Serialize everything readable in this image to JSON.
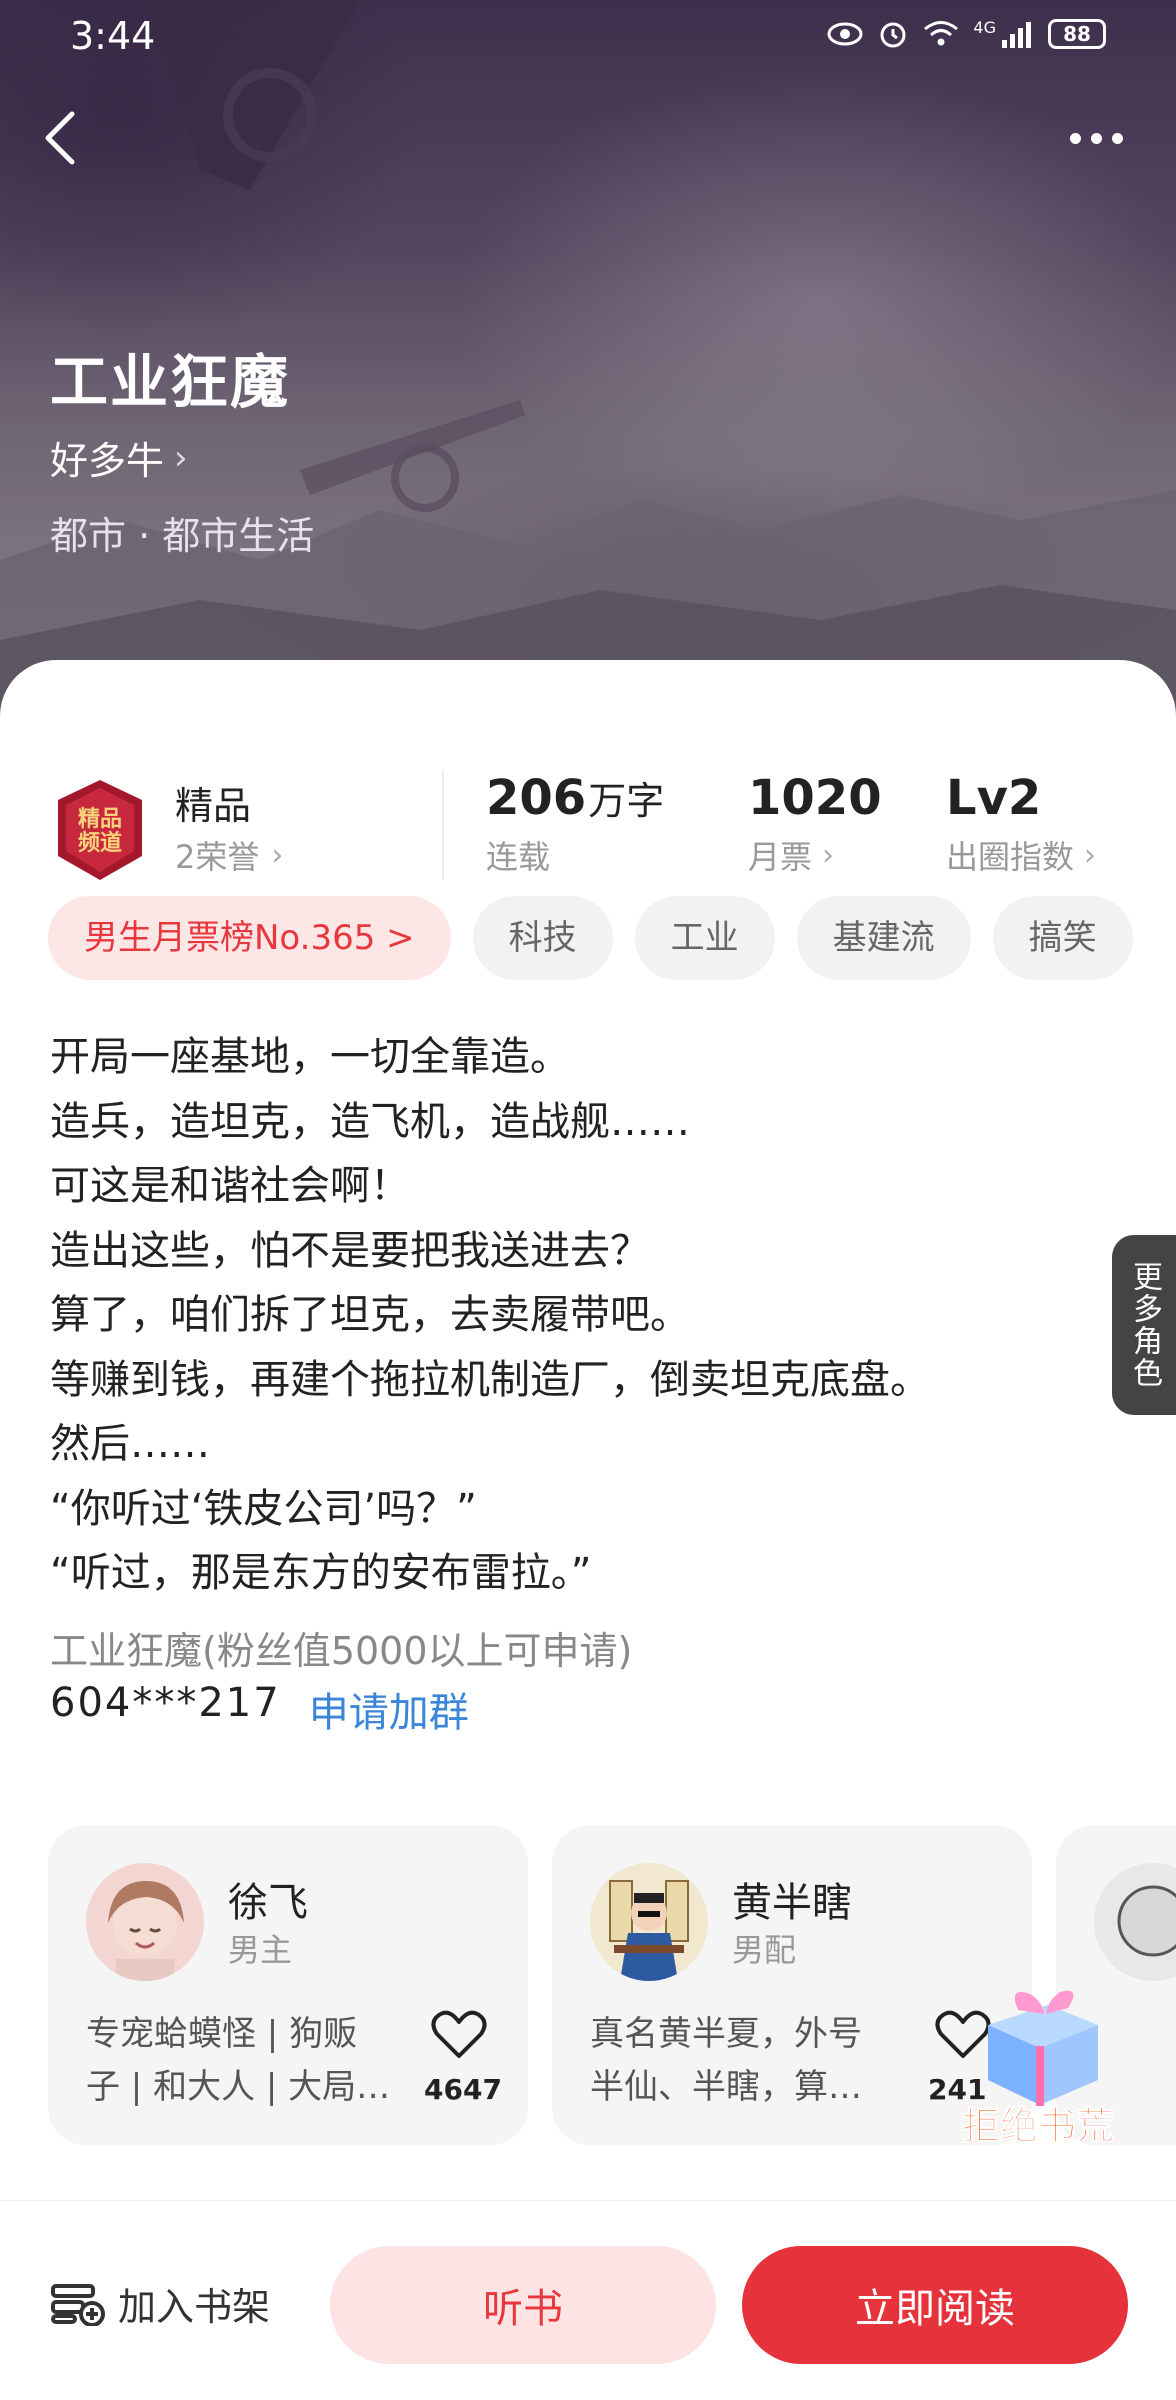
{
  "status": {
    "time": "3:44",
    "network": "4G",
    "battery": "88"
  },
  "book": {
    "title": "工业狂魔",
    "author": "好多牛",
    "genre": "都市 · 都市生活"
  },
  "stats": {
    "quality_label": "精品",
    "honors": "2荣誉",
    "word_count": "206",
    "word_unit": "万字",
    "status_label": "连载",
    "monthly_votes": "1020",
    "monthly_votes_label": "月票",
    "level": "Lv2",
    "level_label": "出圈指数"
  },
  "tags": {
    "rank": "男生月票榜No.365 >",
    "t1": "科技",
    "t2": "工业",
    "t3": "基建流",
    "t4": "搞笑"
  },
  "description": [
    "开局一座基地，一切全靠造。",
    "造兵，造坦克，造飞机，造战舰……",
    "可这是和谐社会啊！",
    "造出这些，怕不是要把我送进去？",
    "算了，咱们拆了坦克，去卖履带吧。",
    "等赚到钱，再建个拖拉机制造厂，倒卖坦克底盘。",
    "然后……",
    "“你听过‘铁皮公司’吗？”",
    "“听过，那是东方的安布雷拉。”"
  ],
  "fan_group": {
    "note": "工业狂魔(粉丝值5000以上可申请)",
    "id": "604***217",
    "join_label": "申请加群"
  },
  "characters": [
    {
      "name": "徐飞",
      "role": "男主",
      "desc_line1": "专宠蛤蟆怪 | 狗贩",
      "desc_line2": "子 | 和大人 | 大局…",
      "likes": "4647"
    },
    {
      "name": "黄半瞎",
      "role": "男配",
      "desc_line1": "真名黄半夏，外号",
      "desc_line2": "半仙、半瞎，算…",
      "likes": "241"
    }
  ],
  "more_characters_label": "更多角色",
  "promo_label": "拒绝书荒",
  "bottom": {
    "shelf_label": "加入书架",
    "listen_label": "听书",
    "read_label": "立即阅读"
  },
  "colors": {
    "accent_red": "#e5323b",
    "link_blue": "#3a86d8",
    "tag_bg": "#f2f2f2"
  }
}
